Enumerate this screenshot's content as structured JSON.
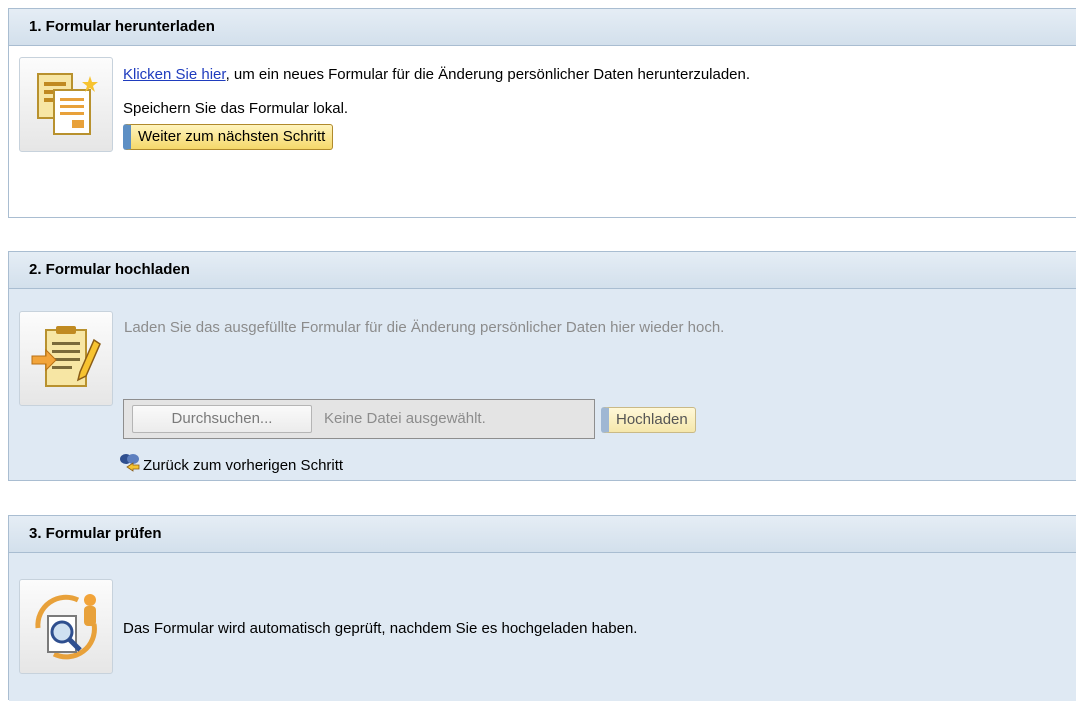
{
  "step1": {
    "title": "1. Formular herunterladen",
    "icon": "form-download-icon",
    "link_text": "Klicken Sie hier",
    "description_rest": ", um ein neues Formular für die Änderung persönlicher Daten herunterzuladen.",
    "save_hint": "Speichern Sie das Formular lokal.",
    "next_button": "Weiter zum nächsten Schritt"
  },
  "step2": {
    "title": "2. Formular hochladen",
    "icon": "form-upload-icon",
    "description": "Laden Sie das ausgefüllte Formular für die Änderung persönlicher Daten hier wieder hoch.",
    "browse_button": "Durchsuchen...",
    "file_status": "Keine Datei ausgewählt.",
    "upload_button": "Hochladen",
    "back_link": "Zurück zum vorherigen Schritt"
  },
  "step3": {
    "title": "3. Formular prüfen",
    "icon": "form-check-icon",
    "description": "Das Formular wird automatisch geprüft, nachdem Sie es hochgeladen haben."
  },
  "colors": {
    "header_bg": "#d3e0ec",
    "panel_border": "#a9bdd1",
    "inactive_body": "#dfe9f3",
    "link": "#1f3cbe",
    "button_yellow": "#f5d86a",
    "button_accent": "#5d8fc4"
  }
}
